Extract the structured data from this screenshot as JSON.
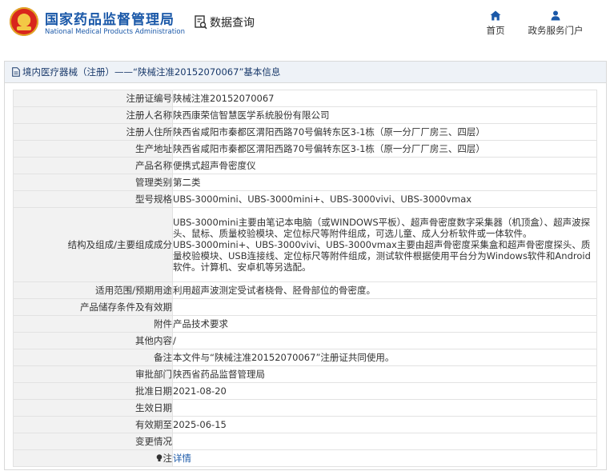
{
  "header": {
    "brand_cn": "国家药品监督管理局",
    "brand_en": "National Medical Products Administration",
    "query_label": "数据查询",
    "nav": [
      {
        "label": "首页",
        "icon": "home-icon"
      },
      {
        "label": "政务服务门户",
        "icon": "person-icon"
      }
    ],
    "brand_color": "#1a58a8"
  },
  "panel": {
    "title": "境内医疗器械（注册）——“陕械注准20152070067”基本信息"
  },
  "rows": [
    {
      "label": "注册证编号",
      "value": "陕械注准20152070067"
    },
    {
      "label": "注册人名称",
      "value": "陕西康荣信智慧医学系统股份有限公司"
    },
    {
      "label": "注册人住所",
      "value": "陕西省咸阳市秦都区渭阳西路70号偏转东区3-1栋（原一分厂厂房三、四层）"
    },
    {
      "label": "生产地址",
      "value": "陕西省咸阳市秦都区渭阳西路70号偏转东区3-1栋（原一分厂厂房三、四层）"
    },
    {
      "label": "产品名称",
      "value": "便携式超声骨密度仪"
    },
    {
      "label": "管理类别",
      "value": "第二类"
    },
    {
      "label": "型号规格",
      "value": "UBS-3000mini、UBS-3000mini+、UBS-3000vivi、UBS-3000vmax"
    },
    {
      "label": "结构及组成/主要组成成分",
      "value": "UBS-3000mini主要由笔记本电脑（或WINDOWS平板）、超声骨密度数字采集器（机顶盒）、超声波探头、鼠标、质量校验模块、定位标尺等附件组成，可选儿童、成人分析软件或一体软件。\nUBS-3000mini+、UBS-3000vivi、UBS-3000vmax主要由超声骨密度采集盒和超声骨密度探头、质量校验模块、USB连接线、定位标尺等附件组成，测试软件根据使用平台分为Windows软件和Android软件。计算机、安卓机等另选配。"
    },
    {
      "label": "适用范围/预期用途",
      "value": "利用超声波测定受试者桡骨、胫骨部位的骨密度。"
    },
    {
      "label": "产品储存条件及有效期",
      "value": ""
    },
    {
      "label": "附件",
      "value": "产品技术要求"
    },
    {
      "label": "其他内容",
      "value": "/"
    },
    {
      "label": "备注",
      "value": "本文件与“陕械注准20152070067”注册证共同使用。"
    },
    {
      "label": "审批部门",
      "value": "陕西省药品监督管理局"
    },
    {
      "label": "批准日期",
      "value": "2021-08-20"
    },
    {
      "label": "生效日期",
      "value": ""
    },
    {
      "label": "有效期至",
      "value": "2025-06-15"
    },
    {
      "label": "变更情况",
      "value": ""
    },
    {
      "label": "注",
      "value": "详情",
      "icon": "bulb-icon"
    }
  ]
}
